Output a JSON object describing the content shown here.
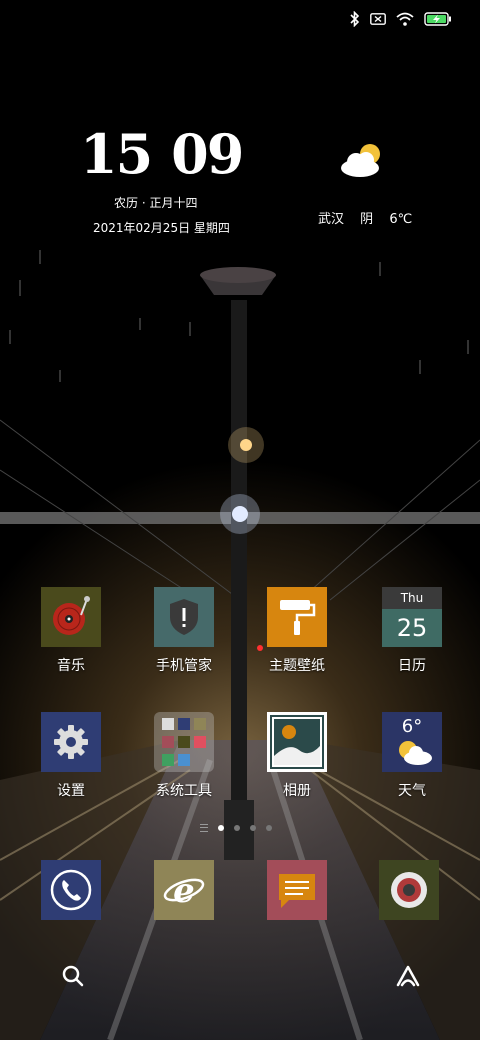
{
  "clock": {
    "hour": "15",
    "minute": "09",
    "lunar": "农历 · 正月十四",
    "date": "2021年02月25日  星期四"
  },
  "weather": {
    "city": "武汉",
    "condition": "阴",
    "temp": "6℃"
  },
  "apps_row1": [
    {
      "label": "音乐",
      "icon": "vinyl-record-icon",
      "bg": "#4a4a1c"
    },
    {
      "label": "手机管家",
      "icon": "shield-icon",
      "bg": "#466a6a"
    },
    {
      "label": "主题壁纸",
      "icon": "paint-roller-icon",
      "bg": "#d7860f"
    },
    {
      "label": "日历",
      "icon": "calendar-icon",
      "bg": "#3f6b64",
      "day": "Thu",
      "date": "25"
    }
  ],
  "apps_row2": [
    {
      "label": "设置",
      "icon": "gear-icon",
      "bg": "#2f3d74"
    },
    {
      "label": "系统工具",
      "icon": "folder-icon"
    },
    {
      "label": "相册",
      "icon": "photo-icon",
      "bg": "#ffffff"
    },
    {
      "label": "天气",
      "icon": "weather-icon",
      "bg": "#2b3566",
      "temp": "6°"
    }
  ],
  "dock": [
    {
      "icon": "phone-icon",
      "bg": "#2f3d74"
    },
    {
      "icon": "browser-icon",
      "bg": "#8f8557"
    },
    {
      "icon": "message-icon",
      "bg": "#a34d59"
    },
    {
      "icon": "camera-icon",
      "bg": "#3e4521"
    }
  ],
  "colors": {
    "accent": "#e5b93a"
  }
}
